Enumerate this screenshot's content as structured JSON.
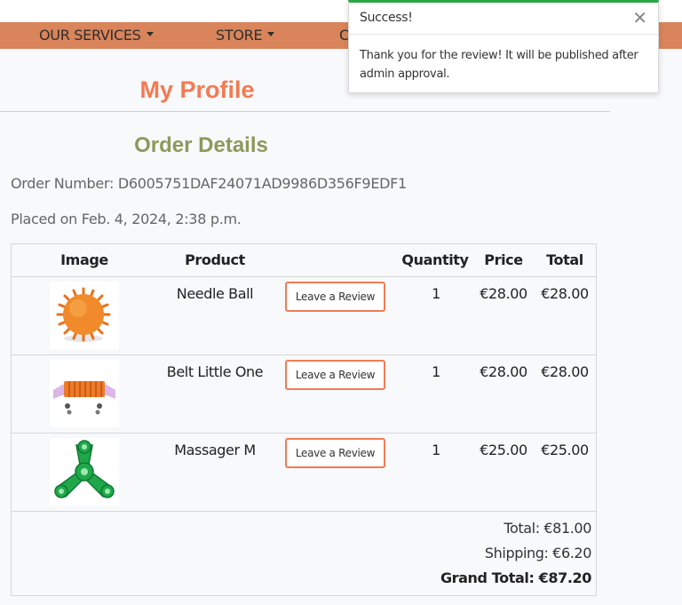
{
  "nav": {
    "items": [
      {
        "label": "OUR SERVICES"
      },
      {
        "label": "STORE"
      },
      {
        "label": "C"
      }
    ]
  },
  "profile": {
    "title": "My Profile"
  },
  "order": {
    "title": "Order Details",
    "number_line": "Order Number: D6005751DAF24071AD9986D356F9EDF1",
    "placed_line": "Placed on Feb. 4, 2024, 2:38 p.m.",
    "headers": {
      "image": "Image",
      "product": "Product",
      "quantity": "Quantity",
      "price": "Price",
      "total": "Total"
    },
    "rows": [
      {
        "product": "Needle Ball",
        "review_label": "Leave a Review",
        "quantity": "1",
        "price": "€28.00",
        "total": "€28.00",
        "thumb_icon": "orange-spiky-ball-image"
      },
      {
        "product": "Belt Little One",
        "review_label": "Leave a Review",
        "quantity": "1",
        "price": "€28.00",
        "total": "€28.00",
        "thumb_icon": "massage-belt-image"
      },
      {
        "product": "Massager M",
        "review_label": "Leave a Review",
        "quantity": "1",
        "price": "€25.00",
        "total": "€25.00",
        "thumb_icon": "green-tri-massager-image"
      }
    ],
    "summary": {
      "total": "Total: €81.00",
      "shipping": "Shipping: €6.20",
      "grand_total": "Grand Total: €87.20"
    }
  },
  "toast": {
    "title": "Success!",
    "close_icon": "close-icon",
    "message": "Thank you for the review! It will be published after admin approval.",
    "accent": "#28a745"
  },
  "colors": {
    "navbar": "#d9845a",
    "profile_title": "#f47a52",
    "order_title": "#8c9a5a",
    "review_button_border": "#f07b55"
  }
}
